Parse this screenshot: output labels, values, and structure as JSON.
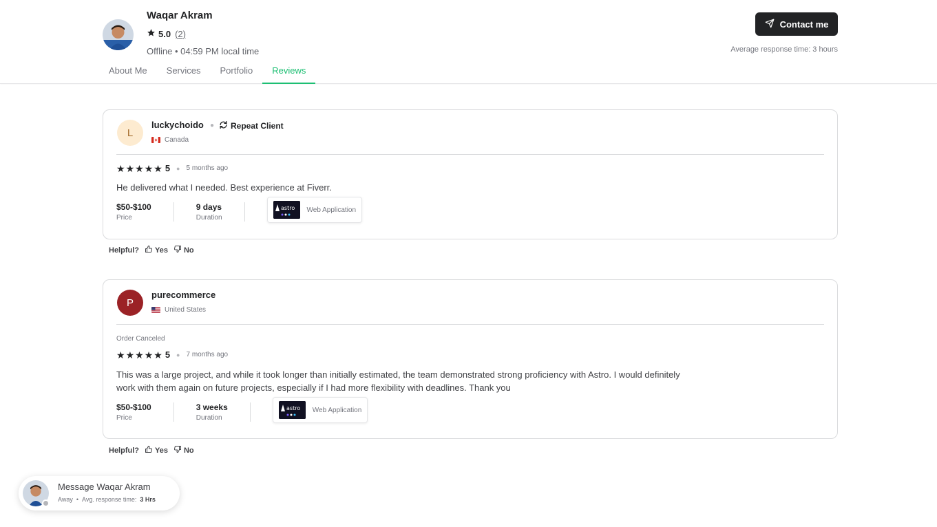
{
  "seller": {
    "name": "Waqar Akram",
    "rating": "5.0",
    "review_count": "(2)",
    "status": "Offline • 04:59 PM local time",
    "contact_label": "Contact me",
    "response_time": "Average response time: 3 hours"
  },
  "tabs": [
    {
      "label": "About Me",
      "active": false
    },
    {
      "label": "Services",
      "active": false
    },
    {
      "label": "Portfolio",
      "active": false
    },
    {
      "label": "Reviews",
      "active": true
    }
  ],
  "reviews": [
    {
      "initial": "L",
      "avatar_bg": "#fdebd0",
      "avatar_fg": "#a36a2b",
      "name": "luckychoido",
      "repeat_client": "Repeat Client",
      "country": "Canada",
      "order_status": "",
      "stars": "5",
      "time_ago": "5 months ago",
      "text": "He delivered what I needed. Best experience at Fiverr.",
      "price": "$50-$100",
      "price_label": "Price",
      "duration": "9 days",
      "duration_label": "Duration",
      "gig_thumb_text": "astro",
      "gig_label": "Web Application",
      "helpful_label": "Helpful?",
      "yes_label": "Yes",
      "no_label": "No"
    },
    {
      "initial": "P",
      "avatar_bg": "#9b2226",
      "avatar_fg": "#ffffff",
      "name": "purecommerce",
      "repeat_client": "",
      "country": "United States",
      "order_status": "Order Canceled",
      "stars": "5",
      "time_ago": "7 months ago",
      "text": "This was a large project, and while it took longer than initially estimated, the team demonstrated strong proficiency with Astro. I would definitely work with them again on future projects, especially if I had more flexibility with deadlines. Thank you",
      "price": "$50-$100",
      "price_label": "Price",
      "duration": "3 weeks",
      "duration_label": "Duration",
      "gig_thumb_text": "astro",
      "gig_label": "Web Application",
      "helpful_label": "Helpful?",
      "yes_label": "Yes",
      "no_label": "No"
    }
  ],
  "message": {
    "title": "Message Waqar Akram",
    "status": "Away",
    "separator": "•",
    "response_prefix": "Avg. response time:",
    "response_value": "3 Hrs"
  },
  "icons": {
    "star": "star-icon",
    "send": "send-icon",
    "repeat": "repeat-icon",
    "thumbs_up": "thumbs-up-icon",
    "thumbs_down": "thumbs-down-icon"
  },
  "colors": {
    "accent": "#1dbf73",
    "dark": "#222325",
    "muted": "#74767e"
  }
}
